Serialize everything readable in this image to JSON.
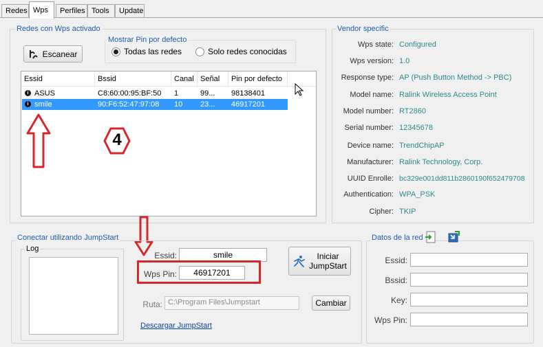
{
  "tabs": [
    "Redes",
    "Wps",
    "Perfiles",
    "Tools",
    "Update"
  ],
  "active_tab": "Wps",
  "networks_group": {
    "title": "Redes con Wps activado",
    "scan_button": "Escanear",
    "pin_group_title": "Mostrar Pin por defecto",
    "radio_all": "Todas las redes",
    "radio_known": "Solo redes conocidas",
    "selected_radio": "all",
    "columns": [
      "Essid",
      "Bssid",
      "Canal",
      "Señal",
      "Pin por defecto"
    ],
    "rows": [
      {
        "essid": "ASUS",
        "bssid": "C8:60:00:95:BF:50",
        "canal": "1",
        "senal": "99...",
        "pin": "98138401",
        "selected": false
      },
      {
        "essid": "smile",
        "bssid": "90:F6:52:47:97:08",
        "canal": "10",
        "senal": "23...",
        "pin": "46917201",
        "selected": true
      }
    ],
    "annotation_number": "4"
  },
  "vendor": {
    "title": "Vendor specific",
    "fields": [
      {
        "label": "Wps state:",
        "value": "Configured"
      },
      {
        "label": "Wps version:",
        "value": "1.0"
      },
      {
        "label": "Response type:",
        "value": "AP (Push Button Method -> PBC)"
      },
      {
        "label": "Model name:",
        "value": "Ralink Wireless Access Point"
      },
      {
        "label": "Model number:",
        "value": "RT2860"
      },
      {
        "label": "Serial number:",
        "value": "12345678"
      },
      {
        "label": "Device name:",
        "value": "TrendChipAP"
      },
      {
        "label": "Manufacturer:",
        "value": "Ralink Technology, Corp."
      },
      {
        "label": "UUID Enrolle:",
        "value": "bc329e001dd811b2860190f652479708"
      },
      {
        "label": "Authentication:",
        "value": "WPA_PSK"
      },
      {
        "label": "Cipher:",
        "value": "TKIP"
      }
    ]
  },
  "jumpstart": {
    "title": "Conectar utilizando JumpStart",
    "log_label": "Log",
    "essid_label": "Essid:",
    "essid_value": "smile",
    "wps_pin_label": "Wps Pin:",
    "wps_pin_value": "46917201",
    "start_button_line1": "Iniciar",
    "start_button_line2": "JumpStart",
    "ruta_label": "Ruta:",
    "ruta_value": "C:\\Program Files\\Jumpstart",
    "change_button": "Cambiar",
    "download_link": "Descargar JumpStart"
  },
  "network_data": {
    "title": "Datos de la red",
    "essid_label": "Essid:",
    "bssid_label": "Bssid:",
    "key_label": "Key:",
    "wps_pin_label": "Wps Pin:",
    "essid_value": "",
    "bssid_value": "",
    "key_value": "",
    "wps_pin_value": ""
  },
  "colors": {
    "group_title": "#1e5dab",
    "vendor_value": "#2b8a8c",
    "selection": "#3399ff",
    "annotation_red": "#d9262b"
  }
}
